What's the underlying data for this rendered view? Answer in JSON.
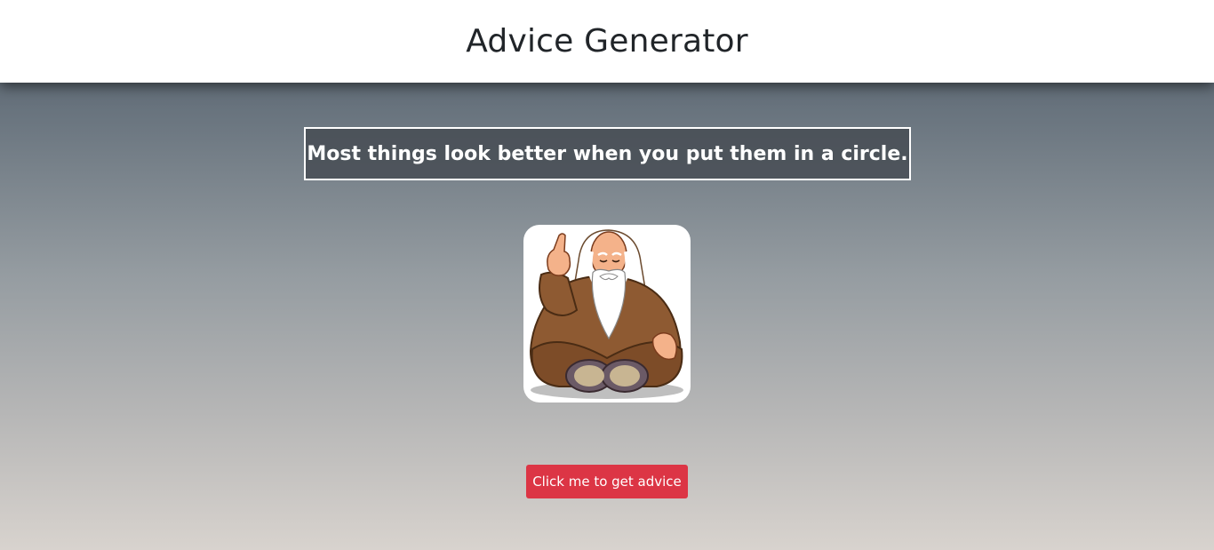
{
  "header": {
    "title": "Advice Generator"
  },
  "advice": {
    "text": "Most things look better when you put them in a circle."
  },
  "illustration": {
    "icon": "meditating-sage-icon"
  },
  "actions": {
    "get_advice_label": "Click me to get advice"
  },
  "colors": {
    "button": "#dc3545",
    "header_bg": "#ffffff",
    "advice_border": "#ffffff"
  }
}
